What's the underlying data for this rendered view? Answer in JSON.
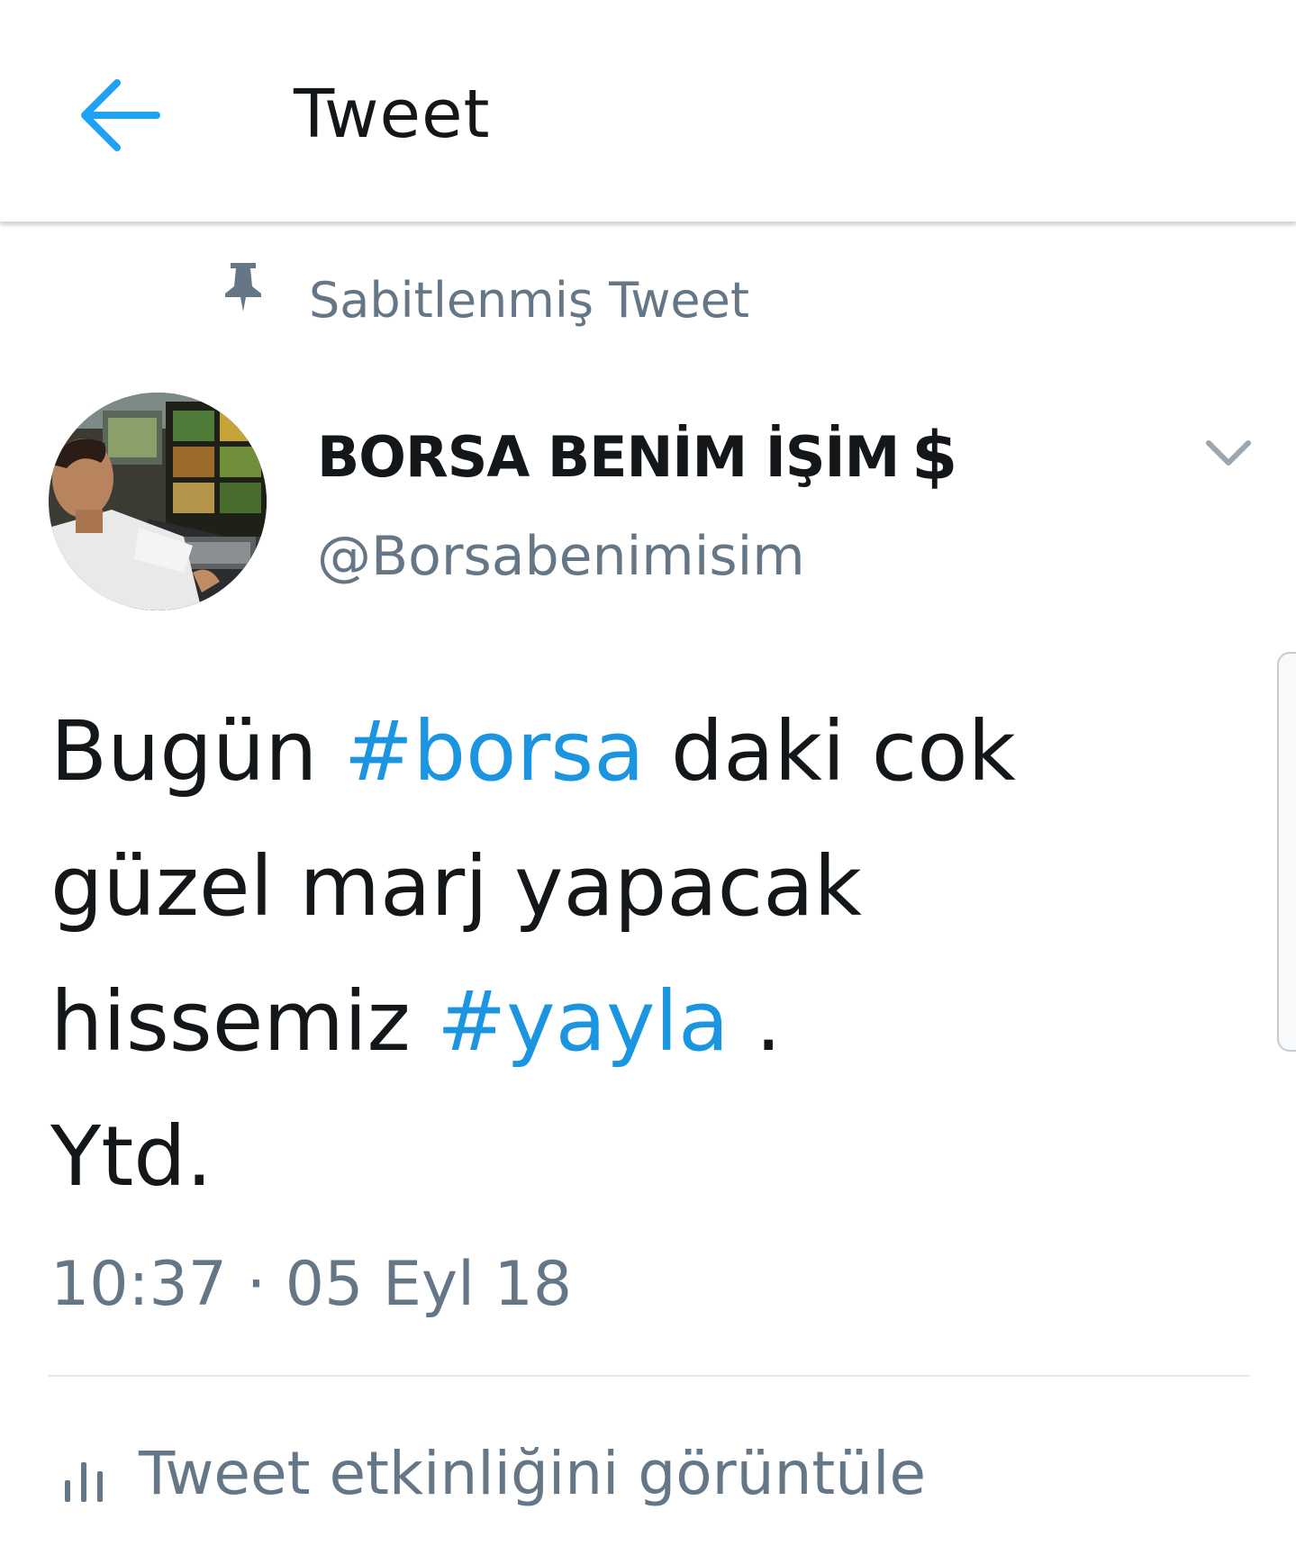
{
  "header": {
    "title": "Tweet",
    "back_icon": "arrow-left-icon"
  },
  "pinned": {
    "icon": "pin-icon",
    "label": "Sabitlenmiş Tweet"
  },
  "author": {
    "display_name": "BORSA BENİM İŞİM",
    "name_suffix": "$",
    "username": "@Borsabenimisim",
    "avatar": "avatar-photo",
    "menu_icon": "chevron-down-icon"
  },
  "tweet": {
    "line1_a": "Bugün ",
    "line1_hashtag": "#borsa",
    "line1_b": " daki cok",
    "line2": "güzel marj yapacak",
    "line3_a": "hissemiz ",
    "line3_hashtag": "#yayla",
    "line3_b": " .",
    "line4": "Ytd.",
    "timestamp": "10:37 · 05 Eyl 18"
  },
  "actions": {
    "activity_icon": "bar-chart-icon",
    "activity_label": "Tweet etkinliğini görüntüle"
  },
  "colors": {
    "accent": "#1da1f2",
    "hashtag": "#1b95e0",
    "secondary_text": "#657786",
    "primary_text": "#14171a",
    "divider": "#e1e8ed"
  }
}
